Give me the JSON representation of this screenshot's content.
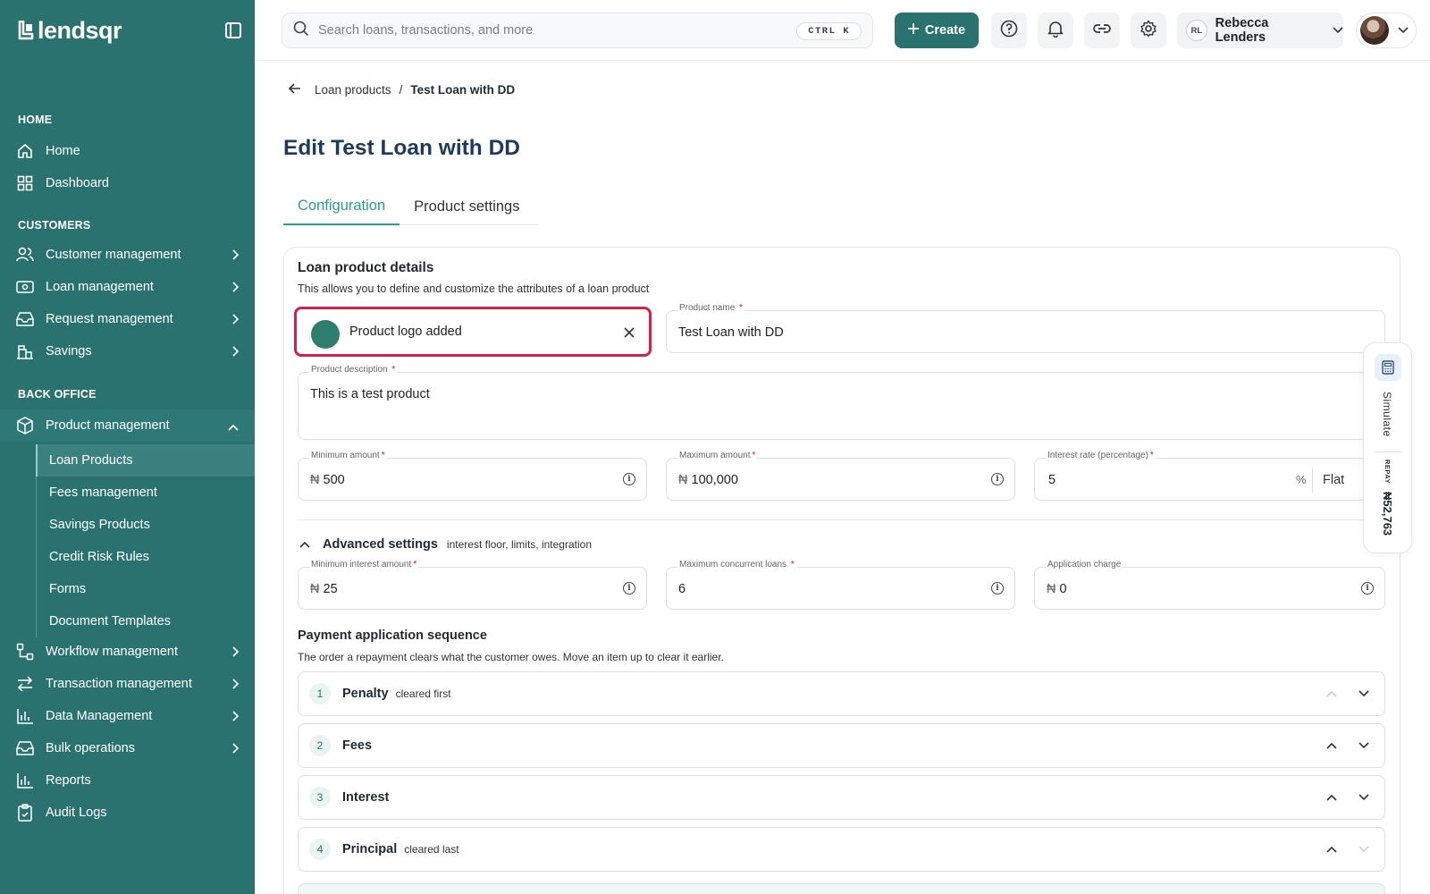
{
  "brand": {
    "name": "lendsqr"
  },
  "sidebar": {
    "sections": {
      "home": "HOME",
      "customers": "CUSTOMERS",
      "back_office": "BACK OFFICE"
    },
    "items": {
      "home": "Home",
      "dashboard": "Dashboard",
      "customer_management": "Customer management",
      "loan_management": "Loan management",
      "request_management": "Request management",
      "savings": "Savings",
      "product_management": "Product management",
      "workflow_management": "Workflow management",
      "transaction_management": "Transaction management",
      "data_management": "Data Management",
      "bulk_operations": "Bulk operations",
      "reports": "Reports",
      "audit_logs": "Audit Logs"
    },
    "product_submenu": [
      "Loan Products",
      "Fees management",
      "Savings Products",
      "Credit Risk Rules",
      "Forms",
      "Document Templates"
    ]
  },
  "topbar": {
    "search_placeholder": "Search loans, transactions, and more",
    "shortcut": "CTRL K",
    "create_label": "Create",
    "user_initials": "RL",
    "user_name": "Rebecca Lenders"
  },
  "breadcrumb": {
    "parent": "Loan products",
    "separator": "/",
    "current": "Test Loan with DD"
  },
  "page": {
    "title": "Edit Test Loan with DD",
    "tabs": [
      "Configuration",
      "Product settings"
    ],
    "active_tab": "Configuration"
  },
  "details": {
    "title": "Loan product details",
    "subtitle": "This allows you to define and customize the attributes of a loan product",
    "logo_status": "Product logo added",
    "product_name": {
      "label": "Product name",
      "value": "Test Loan with DD"
    },
    "description": {
      "label": "Product description",
      "value": "This is a test product"
    },
    "min_amount": {
      "label": "Minimum amount",
      "currency": "₦",
      "value": "500"
    },
    "max_amount": {
      "label": "Maximum amount",
      "currency": "₦",
      "value": "100,000"
    },
    "interest_rate": {
      "label": "Interest rate (percentage)",
      "value": "5",
      "unit": "%",
      "type": "Flat"
    }
  },
  "advanced": {
    "title": "Advanced settings",
    "subtitle": "interest floor, limits, integration",
    "min_interest": {
      "label": "Minimum interest amount",
      "currency": "₦",
      "value": "25"
    },
    "max_loans": {
      "label": "Maximum concurrent loans",
      "value": "6"
    },
    "app_charge": {
      "label": "Application charge",
      "currency": "₦",
      "value": "0"
    }
  },
  "payment_sequence": {
    "title": "Payment application sequence",
    "subtitle": "The order a repayment clears what the customer owes. Move an item up to clear it earlier.",
    "items": [
      {
        "num": "1",
        "label": "Penalty",
        "note": "cleared first"
      },
      {
        "num": "2",
        "label": "Fees",
        "note": ""
      },
      {
        "num": "3",
        "label": "Interest",
        "note": ""
      },
      {
        "num": "4",
        "label": "Principal",
        "note": "cleared last"
      }
    ]
  },
  "simulate": {
    "label": "Simulate",
    "repay_label": "REPAY",
    "amount": "₦52,763"
  },
  "colors": {
    "sidebar": "#2a7270",
    "accent": "#2a9d97",
    "highlight_border": "#d81e4b"
  }
}
